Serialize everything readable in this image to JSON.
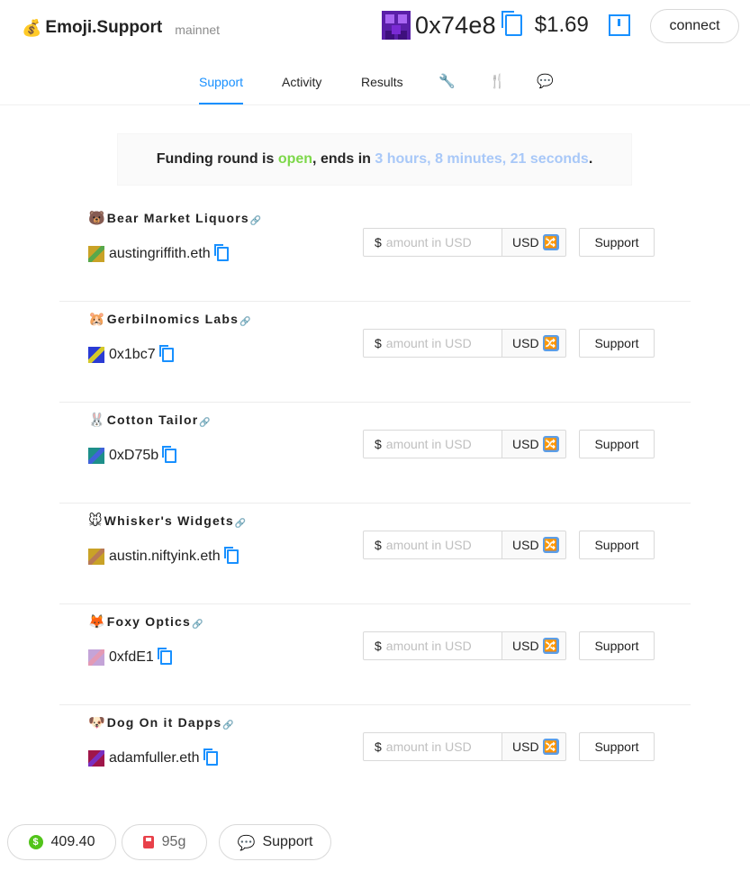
{
  "header": {
    "logo_emoji": "💰",
    "title": "Emoji.Support",
    "network": "mainnet",
    "account_address": "0x74e8",
    "account_balance": "$1.69",
    "connect_label": "connect"
  },
  "tabs": [
    {
      "label": "Support",
      "active": true
    },
    {
      "label": "Activity",
      "active": false
    },
    {
      "label": "Results",
      "active": false
    },
    {
      "icon": "wrench-icon",
      "glyph": "🔧"
    },
    {
      "icon": "fork-knife-icon",
      "glyph": "🍴"
    },
    {
      "icon": "speech-bubble-icon",
      "glyph": "💬"
    }
  ],
  "banner": {
    "prefix": "Funding round is ",
    "status": "open",
    "middle": ", ends in ",
    "countdown": "3 hours, 8 minutes, 21 seconds",
    "suffix": "."
  },
  "projects": [
    {
      "emoji": "🐻",
      "name": "Bear Market Liquors",
      "owner": "austingriffith.eth",
      "avatar_color": "#c9a227",
      "avatar_accent": "#58a84a"
    },
    {
      "emoji": "🐹",
      "name": "Gerbilnomics Labs",
      "owner": "0x1bc7",
      "avatar_color": "#2a3bd4",
      "avatar_accent": "#d4c92a"
    },
    {
      "emoji": "🐰",
      "name": "Cotton Tailor",
      "owner": "0xD75b",
      "avatar_color": "#1e8f8a",
      "avatar_accent": "#3f63d9"
    },
    {
      "emoji": "🐭",
      "name": "Whisker's Widgets",
      "owner": "austin.niftyink.eth",
      "avatar_color": "#c9a227",
      "avatar_accent": "#b87a55"
    },
    {
      "emoji": "🦊",
      "name": "Foxy Optics",
      "owner": "0xfdE1",
      "avatar_color": "#c4a4d8",
      "avatar_accent": "#e39ab5"
    },
    {
      "emoji": "🐶",
      "name": "Dog On it Dapps",
      "owner": "adamfuller.eth",
      "avatar_color": "#a0164a",
      "avatar_accent": "#7a2fc0"
    }
  ],
  "donation_form": {
    "prefix": "$",
    "placeholder": "amount in USD",
    "currency": "USD",
    "currency_toggle_icon": "🔀",
    "support_label": "Support"
  },
  "footer": {
    "balance": "409.40",
    "gas": "95g",
    "gas_icon": "⛽",
    "chat_icon": "💬",
    "support_label": "Support"
  }
}
